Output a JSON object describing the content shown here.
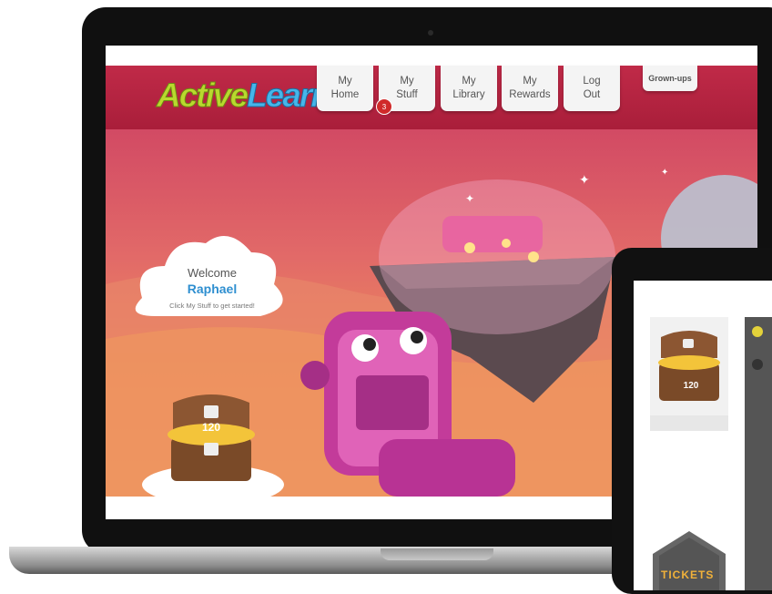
{
  "app": {
    "logo_part1": "Active",
    "logo_part2": "Learn"
  },
  "nav": {
    "items": [
      {
        "label": "My\nHome"
      },
      {
        "label": "My\nStuff"
      },
      {
        "label": "My\nLibrary"
      },
      {
        "label": "My\nRewards"
      },
      {
        "label": "Log\nOut"
      }
    ],
    "grown_ups": "Grown-ups",
    "stuff_badge": "3"
  },
  "welcome": {
    "greeting": "Welcome",
    "name": "Raphael",
    "hint": "Click My Stuff to get started!"
  },
  "rewards": {
    "coins": "120"
  },
  "tablet": {
    "coins": "120",
    "tickets_label": "TICKETS"
  },
  "colors": {
    "header": "#b3223f",
    "logo_active": "#b9d92e",
    "logo_learn": "#46b6ea",
    "name_accent": "#2f8fd0",
    "badge": "#d02a2a"
  }
}
